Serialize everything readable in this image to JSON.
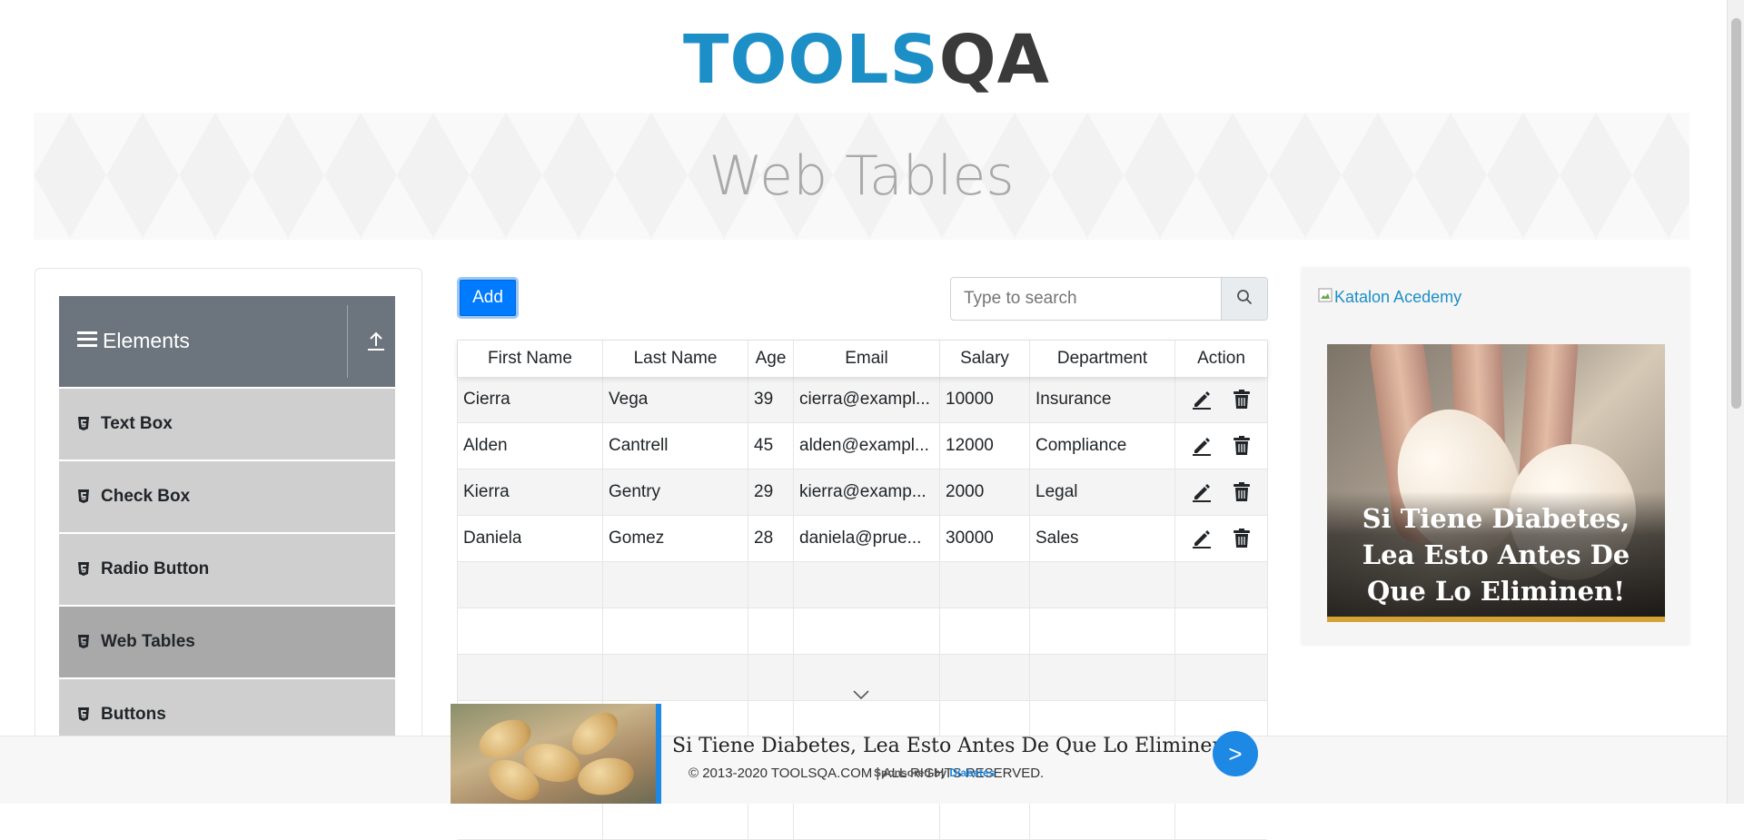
{
  "header": {
    "logo_part1": "TOOLS",
    "logo_part2": "QA"
  },
  "banner": {
    "title": "Web Tables"
  },
  "sidebar": {
    "group_title": "Elements",
    "items": [
      {
        "label": "Text Box",
        "active": false
      },
      {
        "label": "Check Box",
        "active": false
      },
      {
        "label": "Radio Button",
        "active": false
      },
      {
        "label": "Web Tables",
        "active": true
      },
      {
        "label": "Buttons",
        "active": false
      }
    ]
  },
  "toolbar": {
    "add_label": "Add",
    "search_placeholder": "Type to search",
    "search_value": ""
  },
  "table": {
    "headers": [
      "First Name",
      "Last Name",
      "Age",
      "Email",
      "Salary",
      "Department",
      "Action"
    ],
    "rows": [
      [
        "Cierra",
        "Vega",
        "39",
        "cierra@exampl...",
        "10000",
        "Insurance"
      ],
      [
        "Alden",
        "Cantrell",
        "45",
        "alden@exampl...",
        "12000",
        "Compliance"
      ],
      [
        "Kierra",
        "Gentry",
        "29",
        "kierra@examp...",
        "2000",
        "Legal"
      ],
      [
        "Daniela",
        "Gomez",
        "28",
        "daniela@prue...",
        "30000",
        "Sales"
      ],
      [
        "",
        "",
        "",
        "",
        "",
        ""
      ],
      [
        "",
        "",
        "",
        "",
        "",
        ""
      ],
      [
        "",
        "",
        "",
        "",
        "",
        ""
      ],
      [
        "",
        "",
        "",
        "",
        "",
        ""
      ],
      [
        "",
        "",
        "",
        "",
        "",
        ""
      ],
      [
        "",
        "",
        "",
        "",
        "",
        ""
      ]
    ],
    "action_icons": [
      "edit-icon",
      "delete-icon"
    ]
  },
  "right_ad": {
    "image_alt": "Katalon Acedemy",
    "caption": "Si Tiene Diabetes, Lea Esto Antes De Que Lo Eliminen!"
  },
  "footer": {
    "copyright": "© 2013-2020 TOOLSQA.COM | ALL RIGHTS RESERVED."
  },
  "bottom_ad": {
    "text": "Si Tiene Diabetes, Lea Esto Antes De Que Lo Eliminen!",
    "sponsored_prefix": "Sponsored by",
    "sponsor": "Diabetes",
    "go_label": ">"
  },
  "colors": {
    "primary": "#007bff",
    "sidebar_header": "#6c757d",
    "menu_item": "#cfcfcf",
    "menu_item_active": "#a9a9a9",
    "logo_blue": "#1d8fc7"
  }
}
